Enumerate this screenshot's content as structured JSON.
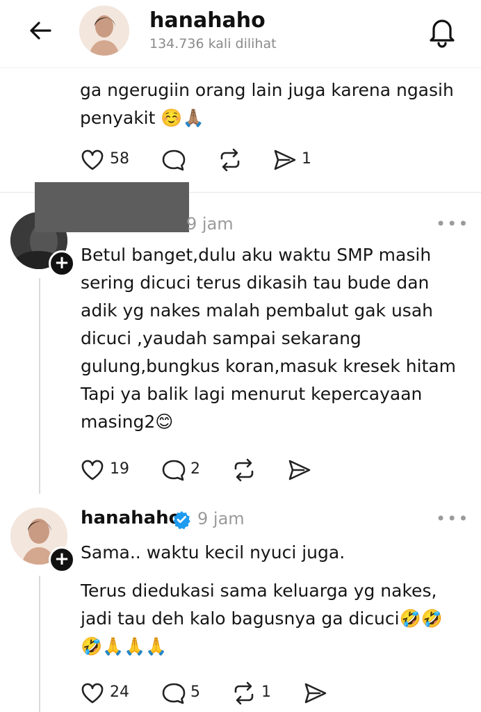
{
  "header": {
    "username": "hanahaho",
    "views": "134.736 kali dilihat"
  },
  "post1": {
    "text_partial": "ga ngerugiin orang lain juga karena ngasih\npenyakit ☺️🙏🏽",
    "likes": "58",
    "shares": "1"
  },
  "reply1": {
    "time": "9 jam",
    "text": "Betul banget,dulu aku waktu SMP masih\nsering dicuci terus dikasih tau bude dan\nadik yg nakes malah pembalut gak usah\ndicuci ,yaudah sampai sekarang\ngulung,bungkus koran,masuk kresek hitam\nTapi ya balik lagi menurut kepercayaan\nmasing2😊",
    "likes": "19",
    "comments": "2"
  },
  "reply2": {
    "username": "hanahaho",
    "time": "9 jam",
    "text1": "Sama.. waktu kecil nyuci juga.",
    "text2": "Terus diedukasi sama keluarga yg nakes,\njadi tau deh kalo bagusnya ga dicuci🤣🤣\n🤣🙏🙏🙏",
    "likes": "24",
    "comments": "5",
    "reposts": "1"
  },
  "more_label": "•••",
  "plus_label": "+",
  "colors": {
    "verified": "#1d9bf0",
    "muted": "#9a9a9a",
    "text": "#151515"
  }
}
